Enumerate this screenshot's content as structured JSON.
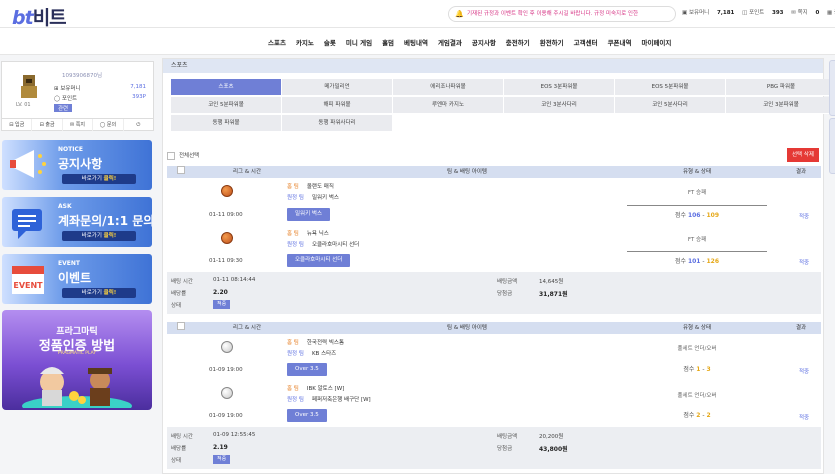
{
  "header": {
    "logo_latin": "bt",
    "logo_korean": "비트",
    "notice": "기재된 규정과 이벤트 확인 후 이용해 주시길 바랍니다. 규정 미숙지로 인한",
    "user": {
      "money_label": "보유머니",
      "money": "7,181",
      "point_label": "포인트",
      "point": "393",
      "message_label": "쪽지",
      "message_count": "0",
      "extra": "충"
    }
  },
  "nav": [
    "스포츠",
    "카지노",
    "슬롯",
    "미니 게임",
    "홀덤",
    "베팅내역",
    "게임결과",
    "공지사항",
    "충전하기",
    "환전하기",
    "고객센터",
    "쿠폰내역",
    "마이페이지"
  ],
  "profile": {
    "user_id": "1093906870님",
    "level": "LV. 01",
    "money_label": "보유머니",
    "money": "7,181",
    "point_label": "포인트",
    "point": "393P",
    "tag": "관련",
    "buttons": [
      "입금",
      "출금",
      "쪽지",
      "문의"
    ]
  },
  "banners": [
    {
      "small": "NOTICE",
      "big": "공지사항",
      "go": "바로가기",
      "go_emph": "클릭!"
    },
    {
      "small": "ASK",
      "big": "계좌문의/1:1 문의",
      "go": "바로가기",
      "go_emph": "클릭!"
    },
    {
      "small": "EVENT",
      "big": "이벤트",
      "go": "바로가기",
      "go_emph": "클릭!"
    }
  ],
  "promo": {
    "line1": "프라그마틱",
    "line2": "정품인증 방법",
    "line3": "PRAGMATIC PLAY"
  },
  "section_title": "스포츠",
  "tabs": [
    [
      "스포츠",
      "메가밀리언",
      "에리조나파워볼",
      "EOS 3분파워볼",
      "EOS 5분파워볼",
      "PBG 파워볼"
    ],
    [
      "코인 5분파워볼",
      "해피 파워볼",
      "루엔마 카지노",
      "코인 3분사다리",
      "코인 5분사다리",
      "코인 3분파워볼"
    ],
    [
      "동행 파워볼",
      "동행 파워사다리"
    ]
  ],
  "select_all": "전체선택",
  "delete_selected": "선택 삭제",
  "columns": {
    "league": "리그 & 시간",
    "team": "팀 & 배팅 아이템",
    "type": "유형 & 상태",
    "result": "결과"
  },
  "bets": [
    {
      "games": [
        {
          "sport": "basketball",
          "home_label": "홈 팀",
          "home": "올랜도 매직",
          "away_label": "원정 팀",
          "away": "밀워키 벅스",
          "datetime": "01-11 09:00",
          "pick": "밀워키 벅스",
          "type": "FT 승패",
          "score_label": "점수",
          "score_home": "106",
          "score_away": "109",
          "result": "적중"
        },
        {
          "sport": "basketball",
          "home_label": "홈 팀",
          "home": "뉴욕 닉스",
          "away_label": "원정 팀",
          "away": "오클라호마시티 선더",
          "datetime": "01-11 09:30",
          "pick": "오클라호마시티 선더",
          "type": "FT 승패",
          "score_label": "점수",
          "score_home": "101",
          "score_away": "126",
          "result": "적중"
        }
      ],
      "summary": {
        "bet_time_label": "배팅 시간",
        "bet_time": "01-11 08:14:44",
        "odds_label": "배당률",
        "odds": "2.20",
        "state_label": "상태",
        "state": "적중",
        "amount_label": "배팅금액",
        "amount": "14,645원",
        "win_label": "당첨금",
        "win": "31,871원"
      }
    },
    {
      "games": [
        {
          "sport": "volleyball",
          "home_label": "홈 팀",
          "home": "한국전력 빅스톰",
          "away_label": "원정 팀",
          "away": "KB 스타즈",
          "datetime": "01-09 19:00",
          "pick": "Over 3.5",
          "type": "풀세트 언더/오버",
          "score_label": "점수",
          "score_home": "1",
          "score_away": "3",
          "result": "적중"
        },
        {
          "sport": "volleyball",
          "home_label": "홈 팀",
          "home": "IBK 알토스 [W]",
          "away_label": "원정 팀",
          "away": "페퍼저축은행 배구단 [W]",
          "datetime": "01-09 19:00",
          "pick": "Over 3.5",
          "type": "풀세트 언더/오버",
          "score_label": "점수",
          "score_home": "2",
          "score_away": "2",
          "result": "적중"
        }
      ],
      "summary": {
        "bet_time_label": "배팅 시간",
        "bet_time": "01-09 12:55:45",
        "odds_label": "배당률",
        "odds": "2.19",
        "state_label": "상태",
        "state": "적중",
        "amount_label": "배팅금액",
        "amount": "20,200원",
        "win_label": "당첨금",
        "win": "43,800원"
      }
    }
  ]
}
